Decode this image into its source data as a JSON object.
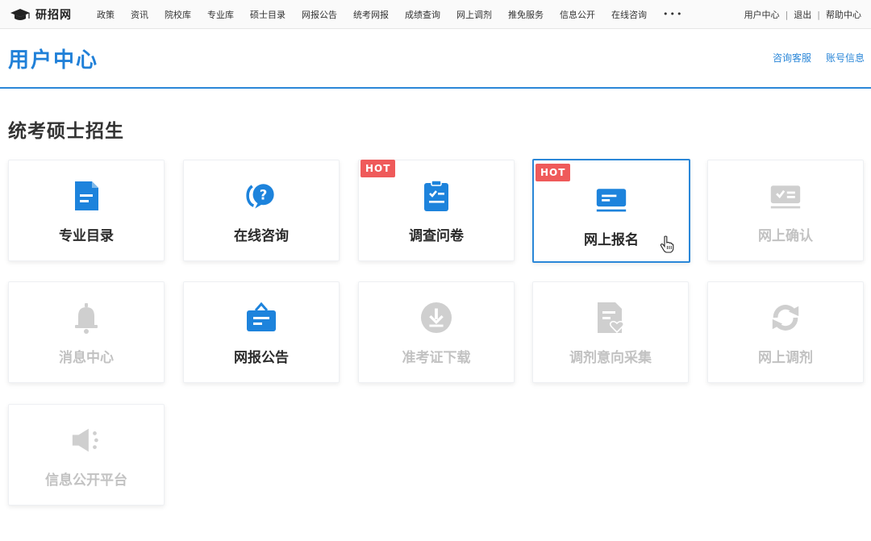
{
  "topnav": {
    "logo_text": "研招网",
    "links": [
      "政策",
      "资讯",
      "院校库",
      "专业库",
      "硕士目录",
      "网报公告",
      "统考网报",
      "成绩查询",
      "网上调剂",
      "推免服务",
      "信息公开",
      "在线咨询"
    ],
    "more": "•••",
    "user_links": [
      "用户中心",
      "退出",
      "帮助中心"
    ],
    "separator": "|"
  },
  "header": {
    "title": "用户中心",
    "links": [
      "咨询客服",
      "账号信息"
    ]
  },
  "section": {
    "title": "统考硕士招生"
  },
  "cards": [
    {
      "label": "专业目录",
      "icon": "document-icon",
      "state": "enabled"
    },
    {
      "label": "在线咨询",
      "icon": "question-chat-icon",
      "state": "enabled"
    },
    {
      "label": "调查问卷",
      "icon": "clipboard-check-icon",
      "state": "enabled",
      "badge": "HOT"
    },
    {
      "label": "网上报名",
      "icon": "id-card-icon",
      "state": "selected",
      "badge": "HOT"
    },
    {
      "label": "网上确认",
      "icon": "card-check-icon",
      "state": "disabled"
    },
    {
      "label": "消息中心",
      "icon": "bell-icon",
      "state": "disabled"
    },
    {
      "label": "网报公告",
      "icon": "notice-board-icon",
      "state": "enabled"
    },
    {
      "label": "准考证下载",
      "icon": "download-icon",
      "state": "disabled"
    },
    {
      "label": "调剂意向采集",
      "icon": "form-heart-icon",
      "state": "disabled"
    },
    {
      "label": "网上调剂",
      "icon": "refresh-icon",
      "state": "disabled"
    },
    {
      "label": "信息公开平台",
      "icon": "speaker-icon",
      "state": "disabled"
    }
  ],
  "colors": {
    "accent": "#2080d8",
    "hot_badge": "#ef5a5a",
    "disabled": "#c2c2c2",
    "enabled_icon": "#1d83dc"
  }
}
